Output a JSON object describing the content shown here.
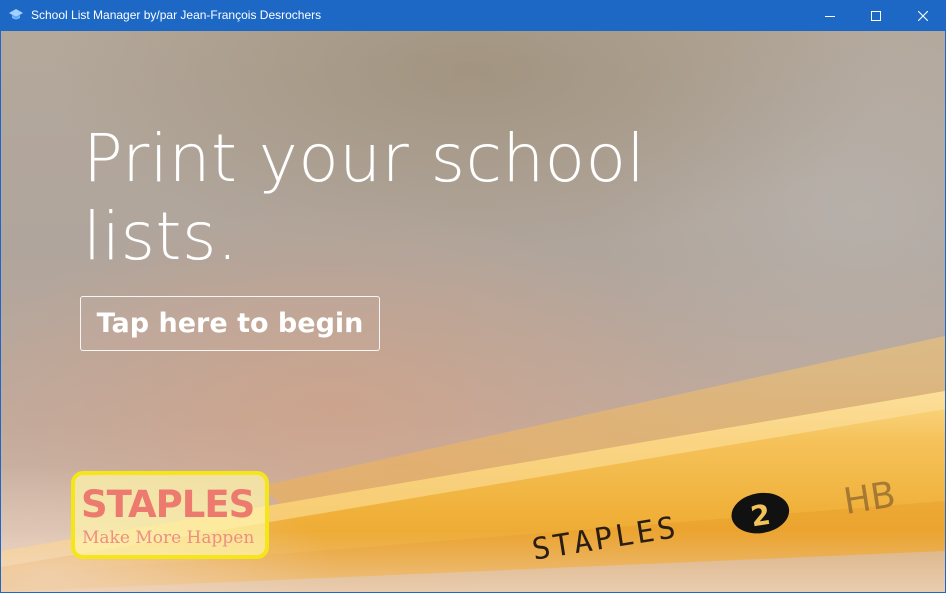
{
  "window": {
    "title": "School List Manager by/par Jean-François Desrochers",
    "icon": "graduation-cap-icon",
    "controls": [
      "minimize-icon",
      "maximize-icon",
      "close-icon"
    ]
  },
  "hero": {
    "title": "Print your school lists.",
    "button_label": "Tap here to begin"
  },
  "logo": {
    "brand": "STAPLES",
    "tagline": "Make More Happen"
  },
  "pencil": {
    "brand": "STAPLES",
    "number": "2",
    "grade": "HB"
  },
  "colors": {
    "titlebar": "#1d68c5",
    "pencil_yellow": "#f2b73c",
    "logo_border": "#f5e61a",
    "logo_text": "#e8706a"
  }
}
